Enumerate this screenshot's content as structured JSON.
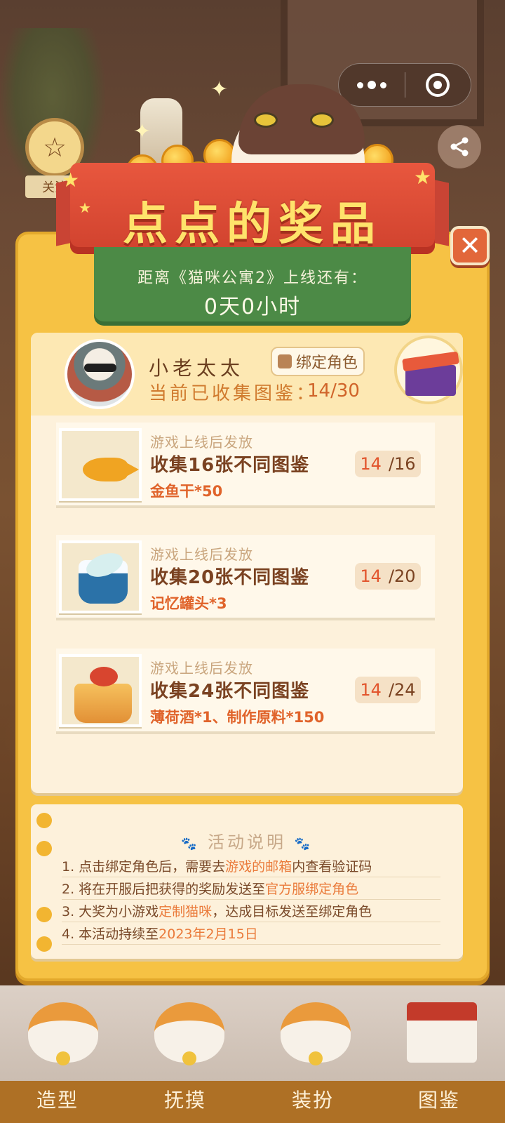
{
  "capsule": {
    "more_icon": "more-dots-icon",
    "close_icon": "target-circle-icon"
  },
  "side": {
    "star_label": "关注",
    "share_icon": "share-icon"
  },
  "banner": {
    "title": "点点的奖品",
    "countdown_label": "距离《猫咪公寓2》上线还有：",
    "countdown_value": "0天0小时"
  },
  "profile": {
    "name": "小老太太",
    "bind_label": "绑定角色",
    "collect_label": "当前已收集图鉴：",
    "collect_value": "14/30"
  },
  "rewards": [
    {
      "note": "游戏上线后发放",
      "title": "收集16张不同图鉴",
      "reward": "金鱼干*50",
      "current": "14",
      "total": "/16",
      "icon": "golden-fish-icon"
    },
    {
      "note": "游戏上线后发放",
      "title": "收集20张不同图鉴",
      "reward": "记忆罐头*3",
      "current": "14",
      "total": "/20",
      "icon": "memory-can-icon"
    },
    {
      "note": "游戏上线后发放",
      "title": "收集24张不同图鉴",
      "reward": "薄荷酒*1、制作原料*150",
      "current": "14",
      "total": "/24",
      "icon": "gift-cake-icon"
    }
  ],
  "notes": {
    "title": "活动说明",
    "lines": [
      {
        "a": "1. 点击绑定角色后，需要去",
        "h": "游戏的邮箱",
        "b": "内查看验证码"
      },
      {
        "a": "2. 将在开服后把获得的奖励发送至",
        "h": "官方服绑定角色",
        "b": ""
      },
      {
        "a": "3. 大奖为小游戏",
        "h": "定制猫咪",
        "b": "，达成目标发送至绑定角色"
      },
      {
        "a": "4. 本活动持续至",
        "h": "2023年2月15日",
        "b": ""
      }
    ]
  },
  "nav": {
    "items": [
      "造型",
      "抚摸",
      "装扮",
      "图鉴"
    ]
  }
}
